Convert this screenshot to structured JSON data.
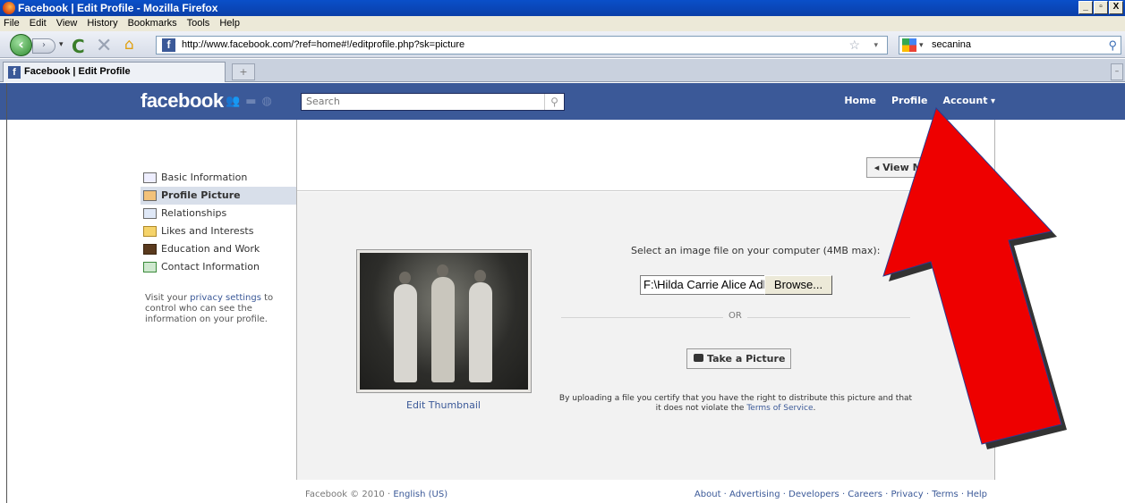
{
  "window": {
    "title": "Facebook | Edit Profile - Mozilla Firefox",
    "controls": [
      "_",
      "▫",
      "X"
    ]
  },
  "menu": [
    "File",
    "Edit",
    "View",
    "History",
    "Bookmarks",
    "Tools",
    "Help"
  ],
  "nav": {
    "url": "http://www.facebook.com/?ref=home#!/editprofile.php?sk=picture",
    "search_value": "secanina"
  },
  "tabs": [
    {
      "label": "Facebook | Edit Profile"
    }
  ],
  "fb": {
    "logo": "facebook",
    "search_placeholder": "Search",
    "nav": {
      "home": "Home",
      "profile": "Profile",
      "account": "Account"
    }
  },
  "sidebar": {
    "items": [
      {
        "label": "Basic Information"
      },
      {
        "label": "Profile Picture"
      },
      {
        "label": "Relationships"
      },
      {
        "label": "Likes and Interests"
      },
      {
        "label": "Education and Work"
      },
      {
        "label": "Contact Information"
      }
    ],
    "privacy_pre": "Visit your ",
    "privacy_link": "privacy settings",
    "privacy_post": " to control who can see the information on your profile."
  },
  "main": {
    "view_profile": "◂ View My Profile",
    "select_label": "Select an image file on your computer (4MB max):",
    "file_value": "F:\\Hilda Carrie Alice Adl",
    "browse": "Browse...",
    "or": "OR",
    "take_picture": "Take a Picture",
    "edit_thumbnail": "Edit Thumbnail",
    "disclaimer_pre": "By uploading a file you certify that you have the right to distribute this picture and that it does not violate the ",
    "disclaimer_link": "Terms of Service",
    "disclaimer_post": "."
  },
  "footer": {
    "left": "Facebook © 2010 · ",
    "lang": "English (US)",
    "right": "About · Advertising · Developers · Careers · Privacy · Terms · Help"
  },
  "colors": {
    "fb_blue": "#3b5998",
    "arrow_red": "#ee0000"
  }
}
